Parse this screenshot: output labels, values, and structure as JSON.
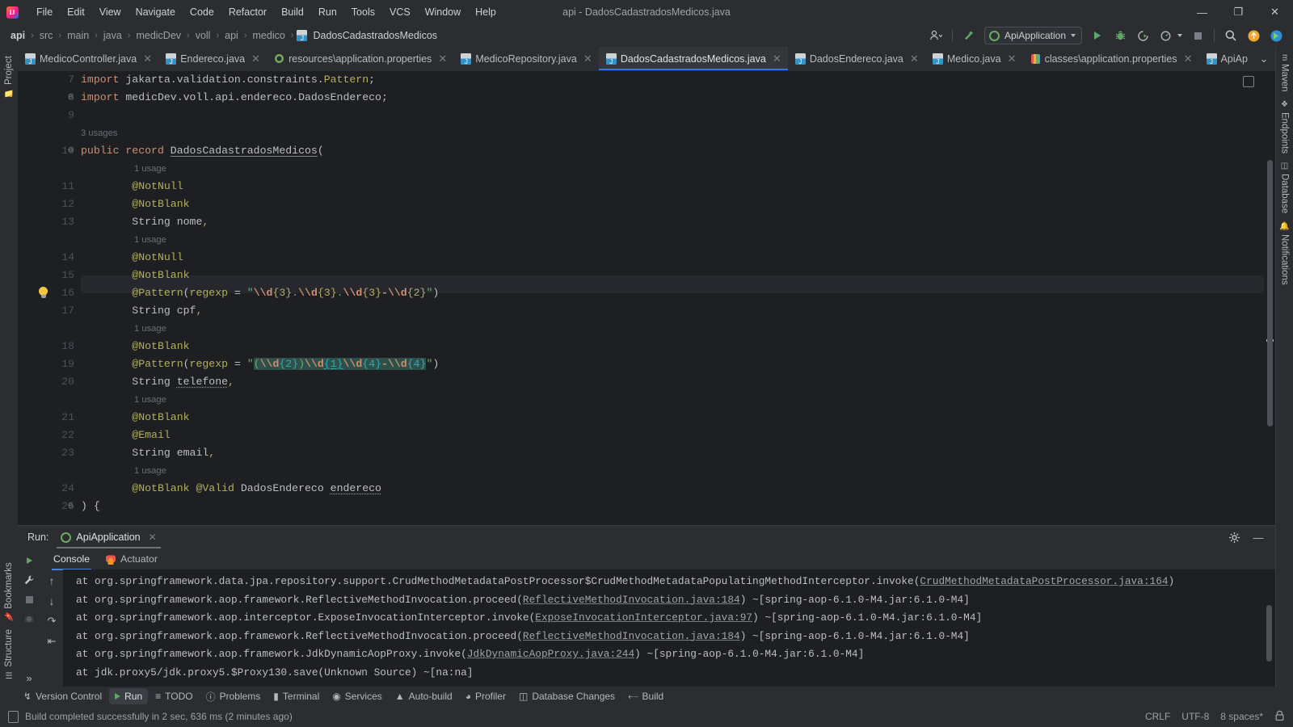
{
  "window": {
    "title": "api - DadosCadastradosMedicos.java",
    "logo_text": "IJ",
    "minimize": "—",
    "maximize": "❐",
    "close": "✕"
  },
  "menu": {
    "items": [
      "File",
      "Edit",
      "View",
      "Navigate",
      "Code",
      "Refactor",
      "Build",
      "Run",
      "Tools",
      "VCS",
      "Window",
      "Help"
    ]
  },
  "breadcrumb": {
    "items": [
      "api",
      "src",
      "main",
      "java",
      "medicDev",
      "voll",
      "api",
      "medico",
      "DadosCadastradosMedicos"
    ],
    "separator": "›"
  },
  "toolbar": {
    "account_icon": "account-icon",
    "build_icon": "hammer-icon",
    "run_config": "ApiApplication",
    "run_label": "Run",
    "debug_label": "Debug",
    "run_coverage_label": "Run with Coverage",
    "profiler_label": "Profiler",
    "stop_label": "Stop",
    "search_label": "Search Everywhere",
    "updates_label": "Updates",
    "more_label": "More"
  },
  "tabs": [
    {
      "label": "MedicoController.java",
      "icon": "java",
      "active": false
    },
    {
      "label": "Endereco.java",
      "icon": "java",
      "active": false
    },
    {
      "label": "resources\\application.properties",
      "icon": "prop",
      "active": false
    },
    {
      "label": "MedicoRepository.java",
      "icon": "java",
      "active": false
    },
    {
      "label": "DadosCadastradosMedicos.java",
      "icon": "java",
      "active": true
    },
    {
      "label": "DadosEndereco.java",
      "icon": "java",
      "active": false
    },
    {
      "label": "Medico.java",
      "icon": "java",
      "active": false
    },
    {
      "label": "classes\\application.properties",
      "icon": "props2",
      "active": false
    },
    {
      "label": "ApiAp",
      "icon": "java",
      "active": false
    }
  ],
  "tabbar_right": {
    "chevron": "⌄",
    "more": "⋮"
  },
  "left_stripe": {
    "top": [
      {
        "label": "Project",
        "icon": "folder-icon"
      }
    ],
    "bottom": [
      {
        "label": "Bookmarks",
        "icon": "bookmark-icon"
      },
      {
        "label": "Structure",
        "icon": "structure-icon"
      }
    ]
  },
  "right_stripe": {
    "top": [
      {
        "label": "Maven",
        "icon": "maven-icon"
      },
      {
        "label": "Endpoints",
        "icon": "endpoints-icon"
      },
      {
        "label": "Database",
        "icon": "database-icon"
      },
      {
        "label": "Notifications",
        "icon": "notifications-icon"
      }
    ]
  },
  "editor": {
    "first_line": 7,
    "lines": [
      {
        "n": 7,
        "hint": null
      },
      {
        "n": 8,
        "hint": null,
        "fold": "⊖"
      },
      {
        "n": 9,
        "hint": null
      },
      {
        "n": null,
        "hint": "3 usages"
      },
      {
        "n": 10,
        "hint": null,
        "fold": "⊖"
      },
      {
        "n": null,
        "hint": "1 usage"
      },
      {
        "n": 11,
        "hint": null
      },
      {
        "n": 12,
        "hint": null
      },
      {
        "n": 13,
        "hint": null
      },
      {
        "n": null,
        "hint": "1 usage"
      },
      {
        "n": 14,
        "hint": null
      },
      {
        "n": 15,
        "hint": null
      },
      {
        "n": 16,
        "hint": null,
        "bulb": true
      },
      {
        "n": 17,
        "hint": null
      },
      {
        "n": null,
        "hint": "1 usage"
      },
      {
        "n": 18,
        "hint": null
      },
      {
        "n": 19,
        "hint": null
      },
      {
        "n": 20,
        "hint": null
      },
      {
        "n": null,
        "hint": "1 usage"
      },
      {
        "n": 21,
        "hint": null
      },
      {
        "n": 22,
        "hint": null
      },
      {
        "n": 23,
        "hint": null
      },
      {
        "n": null,
        "hint": "1 usage"
      },
      {
        "n": 24,
        "hint": null
      },
      {
        "n": 25,
        "hint": null,
        "fold": "⊖"
      }
    ],
    "code_text": [
      "import jakarta.validation.constraints.Pattern;",
      "import medicDev.voll.api.endereco.DadosEndereco;",
      "",
      "3 usages",
      "public record DadosCadastradosMedicos(",
      "1 usage",
      "        @NotNull",
      "        @NotBlank",
      "        String nome,",
      "1 usage",
      "        @NotNull",
      "        @NotBlank",
      "        @Pattern(regexp = \"\\\\d{3}.\\\\d{3}.\\\\d{3}-\\\\d{2}\")",
      "        String cpf,",
      "1 usage",
      "        @NotBlank",
      "        @Pattern(regexp = \"(\\\\d{2})\\\\d{1}\\\\d{4}-\\\\d{4}\")",
      "        String telefone,",
      "1 usage",
      "        @NotBlank",
      "        @Email",
      "        String email,",
      "1 usage",
      "        @NotBlank @Valid DadosEndereco endereco",
      ") {"
    ]
  },
  "run_panel": {
    "label": "Run:",
    "config_name": "ApiApplication",
    "close": "✕",
    "settings_icon": "gear-icon",
    "minimize_icon": "—",
    "side_tools": [
      "rerun-icon",
      "wrench-icon",
      "stop-icon",
      "debug-icon",
      "expand-icon",
      "expand2-icon"
    ],
    "console_tabs": [
      {
        "label": "Console",
        "active": true
      },
      {
        "label": "Actuator",
        "active": false
      }
    ],
    "console_tools": [
      "arrow-up-icon",
      "arrow-down-icon",
      "soft-wrap-icon",
      "scroll-to-end-icon"
    ],
    "console_lines": [
      {
        "pre": "at org.springframework.data.jpa.repository.support.CrudMethodMetadataPostProcessor$CrudMethodMetadataPopulatingMethodInterceptor.invoke(",
        "link": "CrudMethodMetadataPostProcessor.java:164",
        "post": ")"
      },
      {
        "pre": "at org.springframework.aop.framework.ReflectiveMethodInvocation.proceed(",
        "link": "ReflectiveMethodInvocation.java:184",
        "post": ") ~[spring-aop-6.1.0-M4.jar:6.1.0-M4]"
      },
      {
        "pre": "at org.springframework.aop.interceptor.ExposeInvocationInterceptor.invoke(",
        "link": "ExposeInvocationInterceptor.java:97",
        "post": ") ~[spring-aop-6.1.0-M4.jar:6.1.0-M4]"
      },
      {
        "pre": "at org.springframework.aop.framework.ReflectiveMethodInvocation.proceed(",
        "link": "ReflectiveMethodInvocation.java:184",
        "post": ") ~[spring-aop-6.1.0-M4.jar:6.1.0-M4]"
      },
      {
        "pre": "at org.springframework.aop.framework.JdkDynamicAopProxy.invoke(",
        "link": "JdkDynamicAopProxy.java:244",
        "post": ") ~[spring-aop-6.1.0-M4.jar:6.1.0-M4]"
      },
      {
        "pre": "at jdk.proxy5/jdk.proxy5.$Proxy130.save(Unknown Source) ~[na:na]",
        "link": "",
        "post": ""
      }
    ]
  },
  "tool_window_bar": [
    {
      "label": "Version Control",
      "icon": "branch-icon",
      "active": false
    },
    {
      "label": "Run",
      "icon": "run-icon",
      "active": true
    },
    {
      "label": "TODO",
      "icon": "todo-icon",
      "active": false
    },
    {
      "label": "Problems",
      "icon": "problems-icon",
      "active": false
    },
    {
      "label": "Terminal",
      "icon": "terminal-icon",
      "active": false
    },
    {
      "label": "Services",
      "icon": "services-icon",
      "active": false
    },
    {
      "label": "Auto-build",
      "icon": "autobuild-icon",
      "active": false
    },
    {
      "label": "Profiler",
      "icon": "profiler-icon",
      "active": false
    },
    {
      "label": "Database Changes",
      "icon": "db-changes-icon",
      "active": false
    },
    {
      "label": "Build",
      "icon": "build-icon",
      "active": false
    }
  ],
  "status_bar": {
    "message": "Build completed successfully in 2 sec, 636 ms (2 minutes ago)",
    "line_separator": "CRLF",
    "encoding": "UTF-8",
    "indent": "8 spaces*",
    "lock_icon": "lock-icon",
    "memory_icon": "memory-icon"
  }
}
